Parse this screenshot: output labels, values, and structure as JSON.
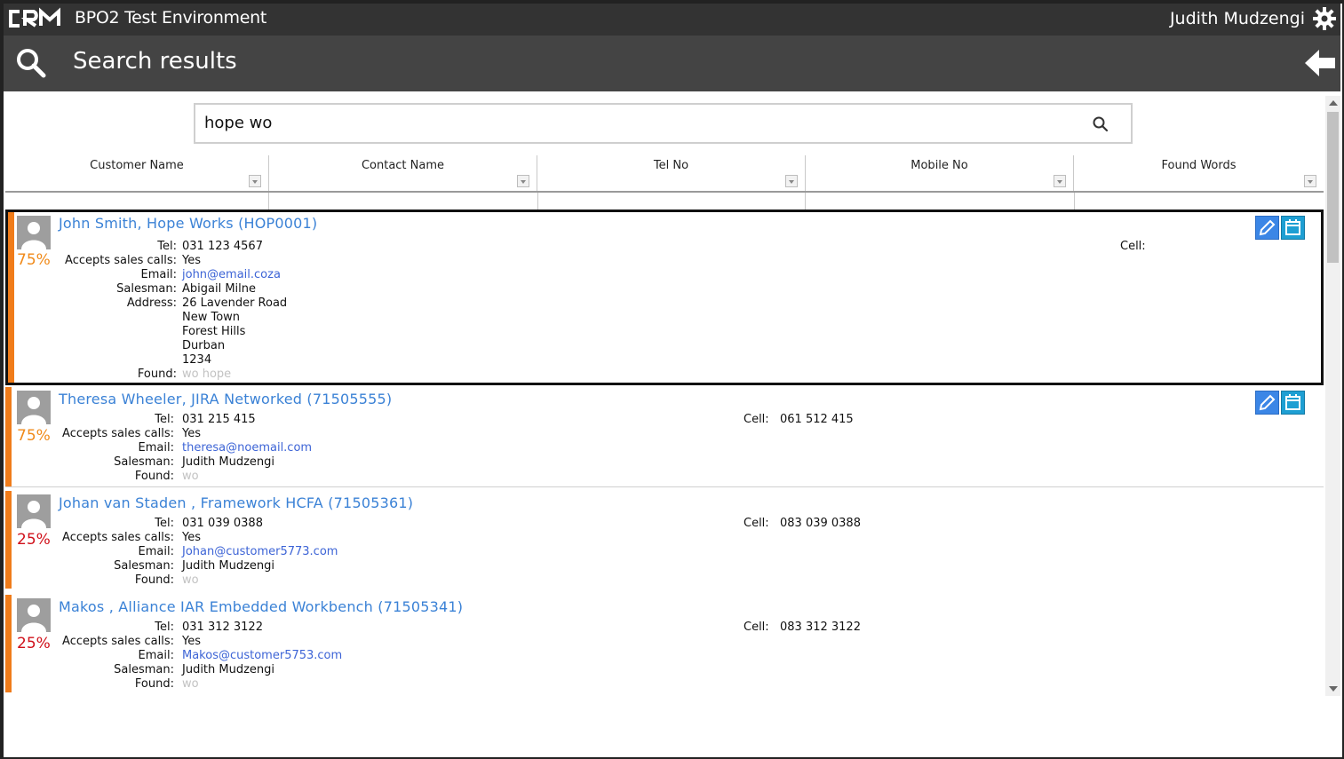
{
  "app": {
    "title": "BPO2 Test Environment",
    "user": "Judith Mudzengi",
    "logo_icon": "crm-logo",
    "settings_icon": "gear-icon"
  },
  "page": {
    "title": "Search results",
    "search_icon": "search-icon",
    "back_icon": "arrow-left-icon"
  },
  "search": {
    "value": "hope wo"
  },
  "columns": [
    "Customer Name",
    "Contact Name",
    "Tel No",
    "Mobile No",
    "Found Words"
  ],
  "labels": {
    "tel": "Tel:",
    "sales": "Accepts sales calls:",
    "email": "Email:",
    "salesman": "Salesman:",
    "address": "Address:",
    "found": "Found:",
    "cell": "Cell:"
  },
  "results": [
    {
      "name": "John Smith, Hope Works (HOP0001)",
      "percent": "75%",
      "tel": "031 123 4567",
      "cell": "",
      "sales": "Yes",
      "email": "john@email.coza",
      "salesman": "Abigail Milne",
      "address": [
        "26 Lavender Road",
        "New Town",
        "Forest Hills",
        "Durban",
        "1234"
      ],
      "found": "wo hope"
    },
    {
      "name": "Theresa Wheeler, JIRA Networked (71505555)",
      "percent": "75%",
      "tel": "031 215 415",
      "cell": "061 512 415",
      "sales": "Yes",
      "email": "theresa@noemail.com",
      "salesman": "Judith Mudzengi",
      "found": "wo"
    },
    {
      "name": "Johan van Staden , Framework HCFA (71505361)",
      "percent": "25%",
      "tel": "031 039 0388",
      "cell": "083 039 0388",
      "sales": "Yes",
      "email": "Johan@customer5773.com",
      "salesman": "Judith Mudzengi",
      "found": "wo"
    },
    {
      "name": "Makos , Alliance IAR Embedded Workbench (71505341)",
      "percent": "25%",
      "tel": "031 312 3122",
      "cell": "083 312 3122",
      "sales": "Yes",
      "email": "Makos@customer5753.com",
      "salesman": "Judith Mudzengi",
      "found": "wo"
    }
  ],
  "colors": {
    "accent": "#f07c1a",
    "link": "#3b82d6",
    "pct_high": "#f08a1a",
    "pct_low": "#d0101a",
    "topbar": "#333333",
    "titlebar": "#444444"
  }
}
